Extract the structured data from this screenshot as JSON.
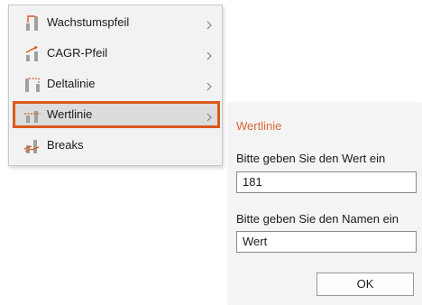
{
  "menu": {
    "items": [
      {
        "label": "Wachstumspfeil",
        "icon": "growth-arrow-icon"
      },
      {
        "label": "CAGR-Pfeil",
        "icon": "cagr-arrow-icon"
      },
      {
        "label": "Deltalinie",
        "icon": "delta-line-icon"
      },
      {
        "label": "Wertlinie",
        "icon": "value-line-icon",
        "selected": true
      },
      {
        "label": "Breaks",
        "icon": "breaks-icon"
      }
    ]
  },
  "panel": {
    "title": "Wertlinie",
    "value_label": "Bitte geben Sie den Wert ein",
    "value": "181",
    "name_label": "Bitte geben Sie den Namen ein",
    "name": "Wert",
    "ok_label": "OK"
  },
  "colors": {
    "accent": "#d9581c",
    "title": "#d9683a",
    "menu_bg": "#f2f2f2",
    "selected_bg": "#dcdcdc"
  }
}
